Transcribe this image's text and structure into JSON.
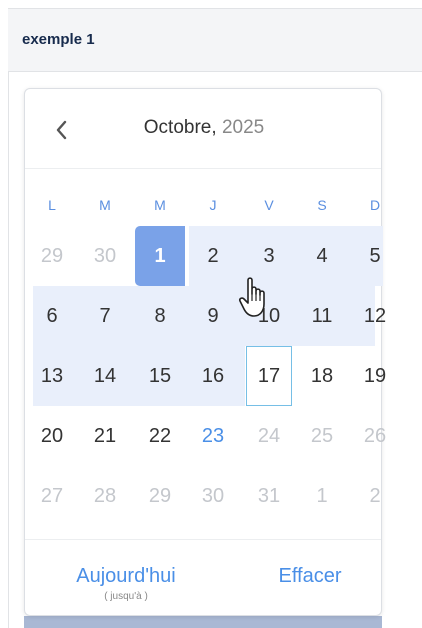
{
  "header": {
    "title": "exemple 1"
  },
  "calendar": {
    "month": "Octobre,",
    "year": "2025",
    "weekdays": [
      "L",
      "M",
      "M",
      "J",
      "V",
      "S",
      "D"
    ],
    "weeks": [
      [
        {
          "d": "29",
          "muted": true
        },
        {
          "d": "30",
          "muted": true
        },
        {
          "d": "1",
          "selected": true
        },
        {
          "d": "2"
        },
        {
          "d": "3"
        },
        {
          "d": "4"
        },
        {
          "d": "5"
        }
      ],
      [
        {
          "d": "6"
        },
        {
          "d": "7"
        },
        {
          "d": "8"
        },
        {
          "d": "9"
        },
        {
          "d": "10"
        },
        {
          "d": "11"
        },
        {
          "d": "12"
        }
      ],
      [
        {
          "d": "13"
        },
        {
          "d": "14"
        },
        {
          "d": "15"
        },
        {
          "d": "16"
        },
        {
          "d": "17",
          "hover": true
        },
        {
          "d": "18"
        },
        {
          "d": "19"
        }
      ],
      [
        {
          "d": "20"
        },
        {
          "d": "21"
        },
        {
          "d": "22"
        },
        {
          "d": "23",
          "today": true
        },
        {
          "d": "24",
          "muted": true
        },
        {
          "d": "25",
          "muted": true
        },
        {
          "d": "26",
          "muted": true
        }
      ],
      [
        {
          "d": "27",
          "muted": true
        },
        {
          "d": "28",
          "muted": true
        },
        {
          "d": "29",
          "muted": true
        },
        {
          "d": "30",
          "muted": true
        },
        {
          "d": "31",
          "muted": true
        },
        {
          "d": "1",
          "muted": true
        },
        {
          "d": "2",
          "muted": true
        }
      ]
    ],
    "range_start": "1",
    "range_end_hover": "17"
  },
  "footer": {
    "today_label": "Aujourd'hui",
    "today_sublabel": "( jusqu'à )",
    "clear_label": "Effacer"
  },
  "icons": {
    "prev": "chevron-left-icon",
    "cursor": "hand-pointer-icon"
  },
  "colors": {
    "accent": "#4a8fe7",
    "selected": "#7aa2e8",
    "range": "#e9effb",
    "hover_border": "#76bfe6"
  }
}
